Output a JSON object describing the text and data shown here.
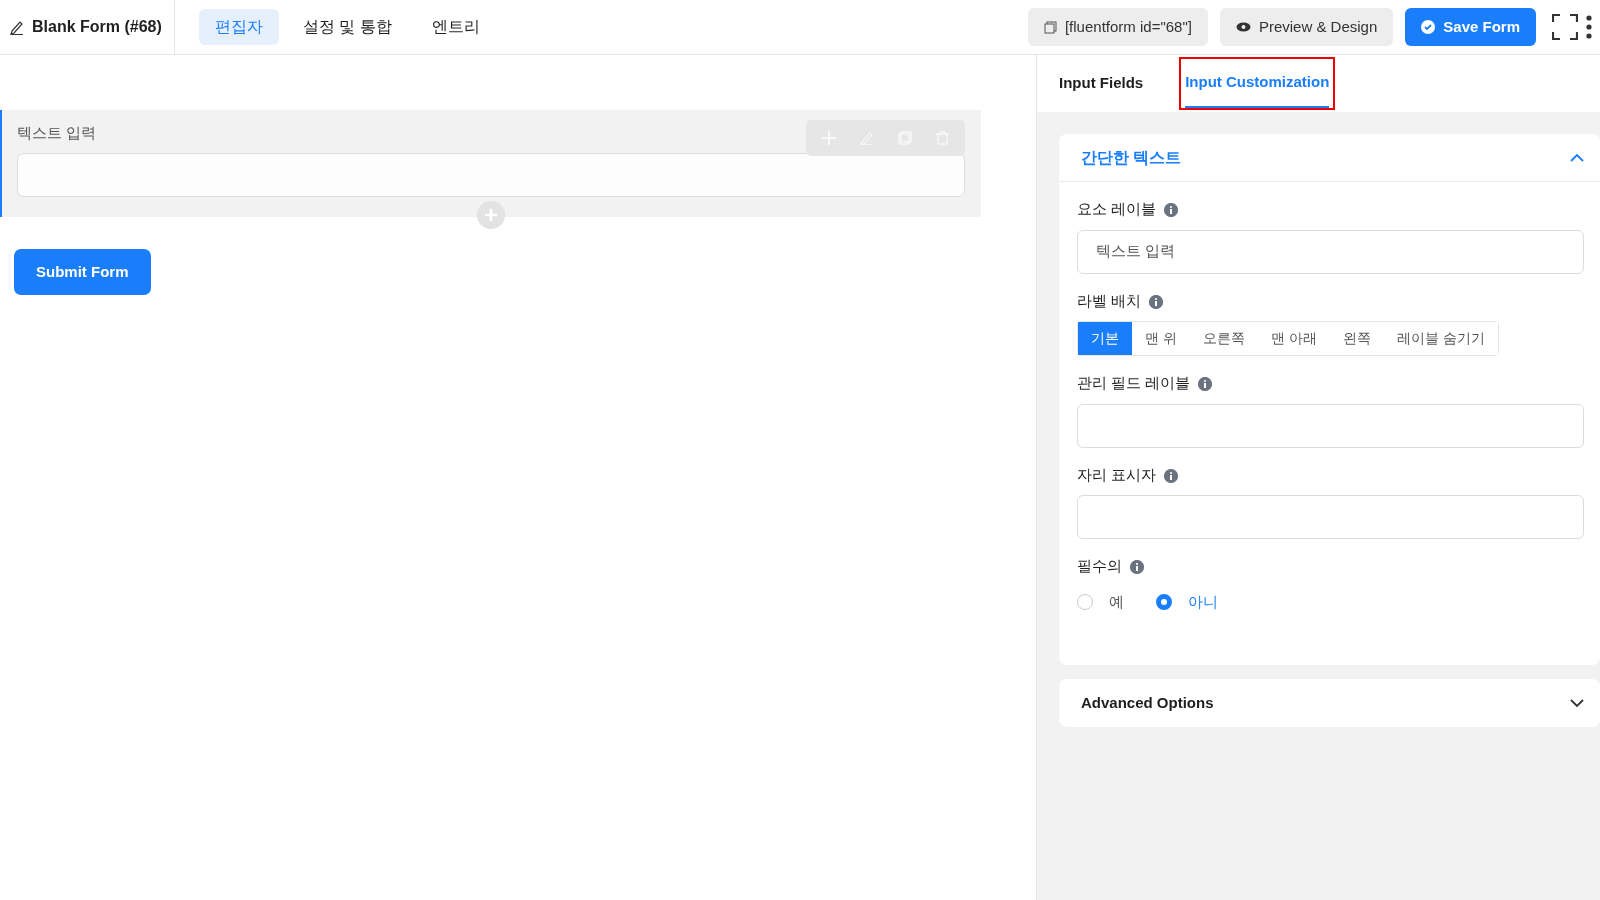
{
  "header": {
    "title": "Blank Form (#68)",
    "tabs": [
      {
        "label": "편집자",
        "selected": true
      },
      {
        "label": "설정 및 통합",
        "selected": false
      },
      {
        "label": "엔트리",
        "selected": false
      }
    ],
    "shortcode": "[fluentform id=\"68\"]",
    "preview": "Preview & Design",
    "save": "Save Form"
  },
  "canvas": {
    "field": {
      "label": "텍스트 입력",
      "selected": true
    },
    "submit": "Submit Form"
  },
  "sidebar": {
    "tabs": [
      {
        "label": "Input Fields",
        "selected": false,
        "highlighted": false
      },
      {
        "label": "Input Customization",
        "selected": true,
        "highlighted": true
      }
    ],
    "section": {
      "title": "간단한 텍스트",
      "expanded": true,
      "settings": [
        {
          "kind": "text",
          "label": "요소 레이블",
          "value": "텍스트 입력"
        },
        {
          "kind": "segmented",
          "label": "라벨 배치",
          "options": [
            {
              "label": "기본",
              "selected": true
            },
            {
              "label": "맨 위",
              "selected": false
            },
            {
              "label": "오른쪽",
              "selected": false
            },
            {
              "label": "맨 아래",
              "selected": false
            },
            {
              "label": "왼쪽",
              "selected": false
            },
            {
              "label": "레이블 숨기기",
              "selected": false
            }
          ]
        },
        {
          "kind": "text",
          "label": "관리 필드 레이블"
        },
        {
          "kind": "text",
          "label": "자리 표시자"
        },
        {
          "kind": "radio",
          "label": "필수의",
          "options": [
            {
              "label": "예",
              "selected": false
            },
            {
              "label": "아니",
              "selected": true
            }
          ]
        }
      ]
    },
    "advanced": {
      "title": "Advanced Options",
      "expanded": false
    }
  }
}
